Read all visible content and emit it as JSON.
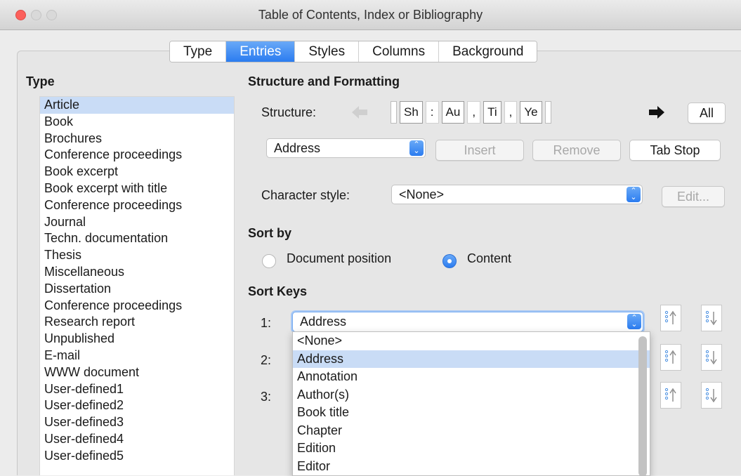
{
  "window": {
    "title": "Table of Contents, Index or Bibliography"
  },
  "tabs": [
    {
      "label": "Type",
      "active": false
    },
    {
      "label": "Entries",
      "active": true
    },
    {
      "label": "Styles",
      "active": false
    },
    {
      "label": "Columns",
      "active": false
    },
    {
      "label": "Background",
      "active": false
    }
  ],
  "type_panel": {
    "heading": "Type",
    "items": [
      "Article",
      "Book",
      "Brochures",
      "Conference proceedings",
      "Book excerpt",
      "Book excerpt with title",
      "Conference proceedings",
      "Journal",
      "Techn. documentation",
      "Thesis",
      "Miscellaneous",
      "Dissertation",
      "Conference proceedings",
      "Research report",
      "Unpublished",
      "E-mail",
      "WWW document",
      "User-defined1",
      "User-defined2",
      "User-defined3",
      "User-defined4",
      "User-defined5"
    ],
    "selected_index": 0
  },
  "structure": {
    "heading": "Structure and Formatting",
    "label": "Structure:",
    "tokens": [
      "Sh",
      ":",
      "Au",
      ",",
      "Ti",
      ",",
      "Ye"
    ],
    "all_label": "All"
  },
  "entry_controls": {
    "field_select": "Address",
    "insert_label": "Insert",
    "remove_label": "Remove",
    "tabstop_label": "Tab Stop"
  },
  "character_style": {
    "label": "Character style:",
    "value": "<None>",
    "edit_label": "Edit..."
  },
  "sort_by": {
    "heading": "Sort by",
    "option_position": "Document position",
    "option_content": "Content",
    "selected": "Content"
  },
  "sort_keys": {
    "heading": "Sort Keys",
    "key1_label": "1:",
    "key2_label": "2:",
    "key3_label": "3:",
    "key1_value": "Address",
    "dropdown_items": [
      "<None>",
      "Address",
      "Annotation",
      "Author(s)",
      "Book title",
      "Chapter",
      "Edition",
      "Editor"
    ],
    "dropdown_selected_index": 1
  },
  "colors": {
    "accent": "#2b7cf0",
    "selection": "#c9dcf6",
    "close": "#fc605c"
  }
}
